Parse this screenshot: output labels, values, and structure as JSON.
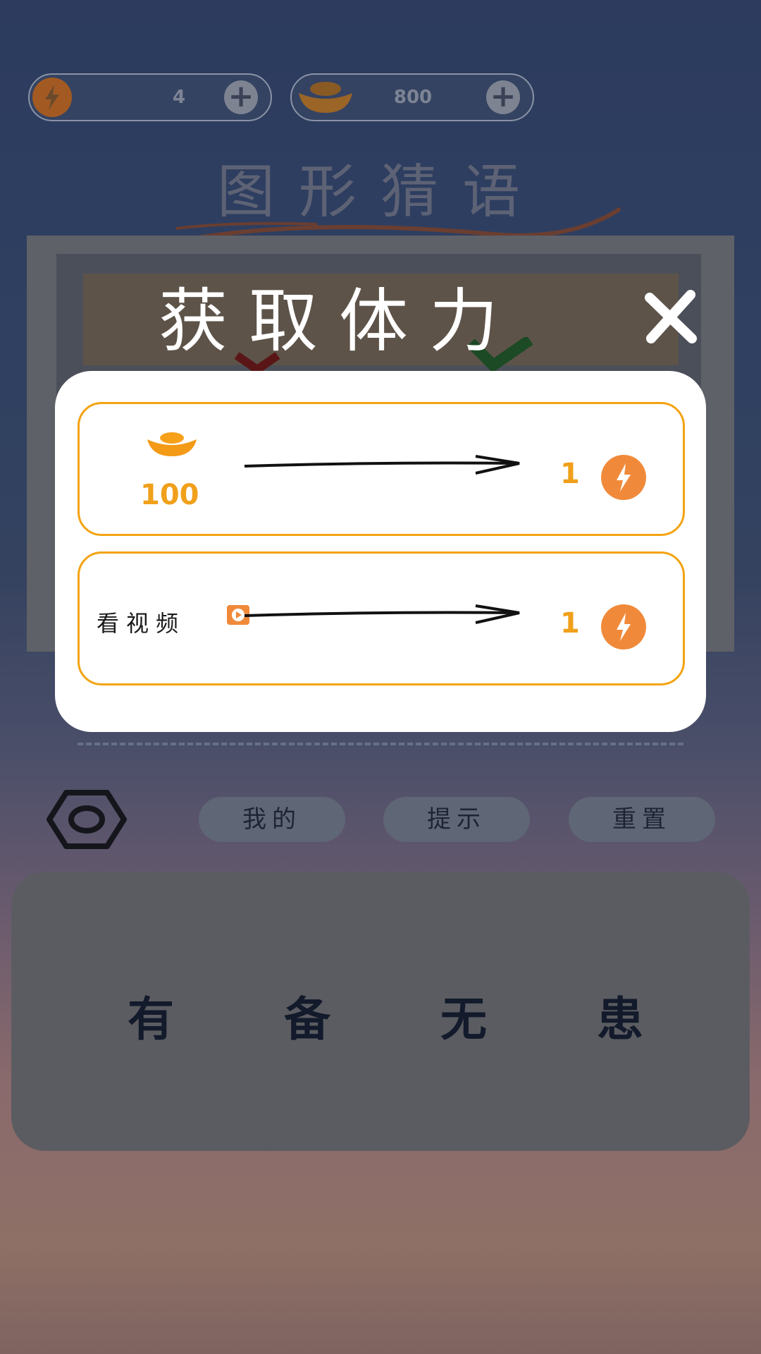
{
  "resources": {
    "energy_value": "4",
    "gold_value": "800"
  },
  "game_title": "图形猜语",
  "modal": {
    "title": "获取体力",
    "options": [
      {
        "cost": "100",
        "reward": "1"
      },
      {
        "label": "看视频",
        "reward": "1"
      }
    ]
  },
  "toolbar": {
    "mine_label": "我的",
    "hint_label": "提示",
    "reset_label": "重置"
  },
  "answer_chars": [
    "有",
    "备",
    "无",
    "患"
  ],
  "colors": {
    "accent_orange": "#f0a01a",
    "bolt_orange": "#f08a3a",
    "modal_bg": "#ffffff"
  }
}
